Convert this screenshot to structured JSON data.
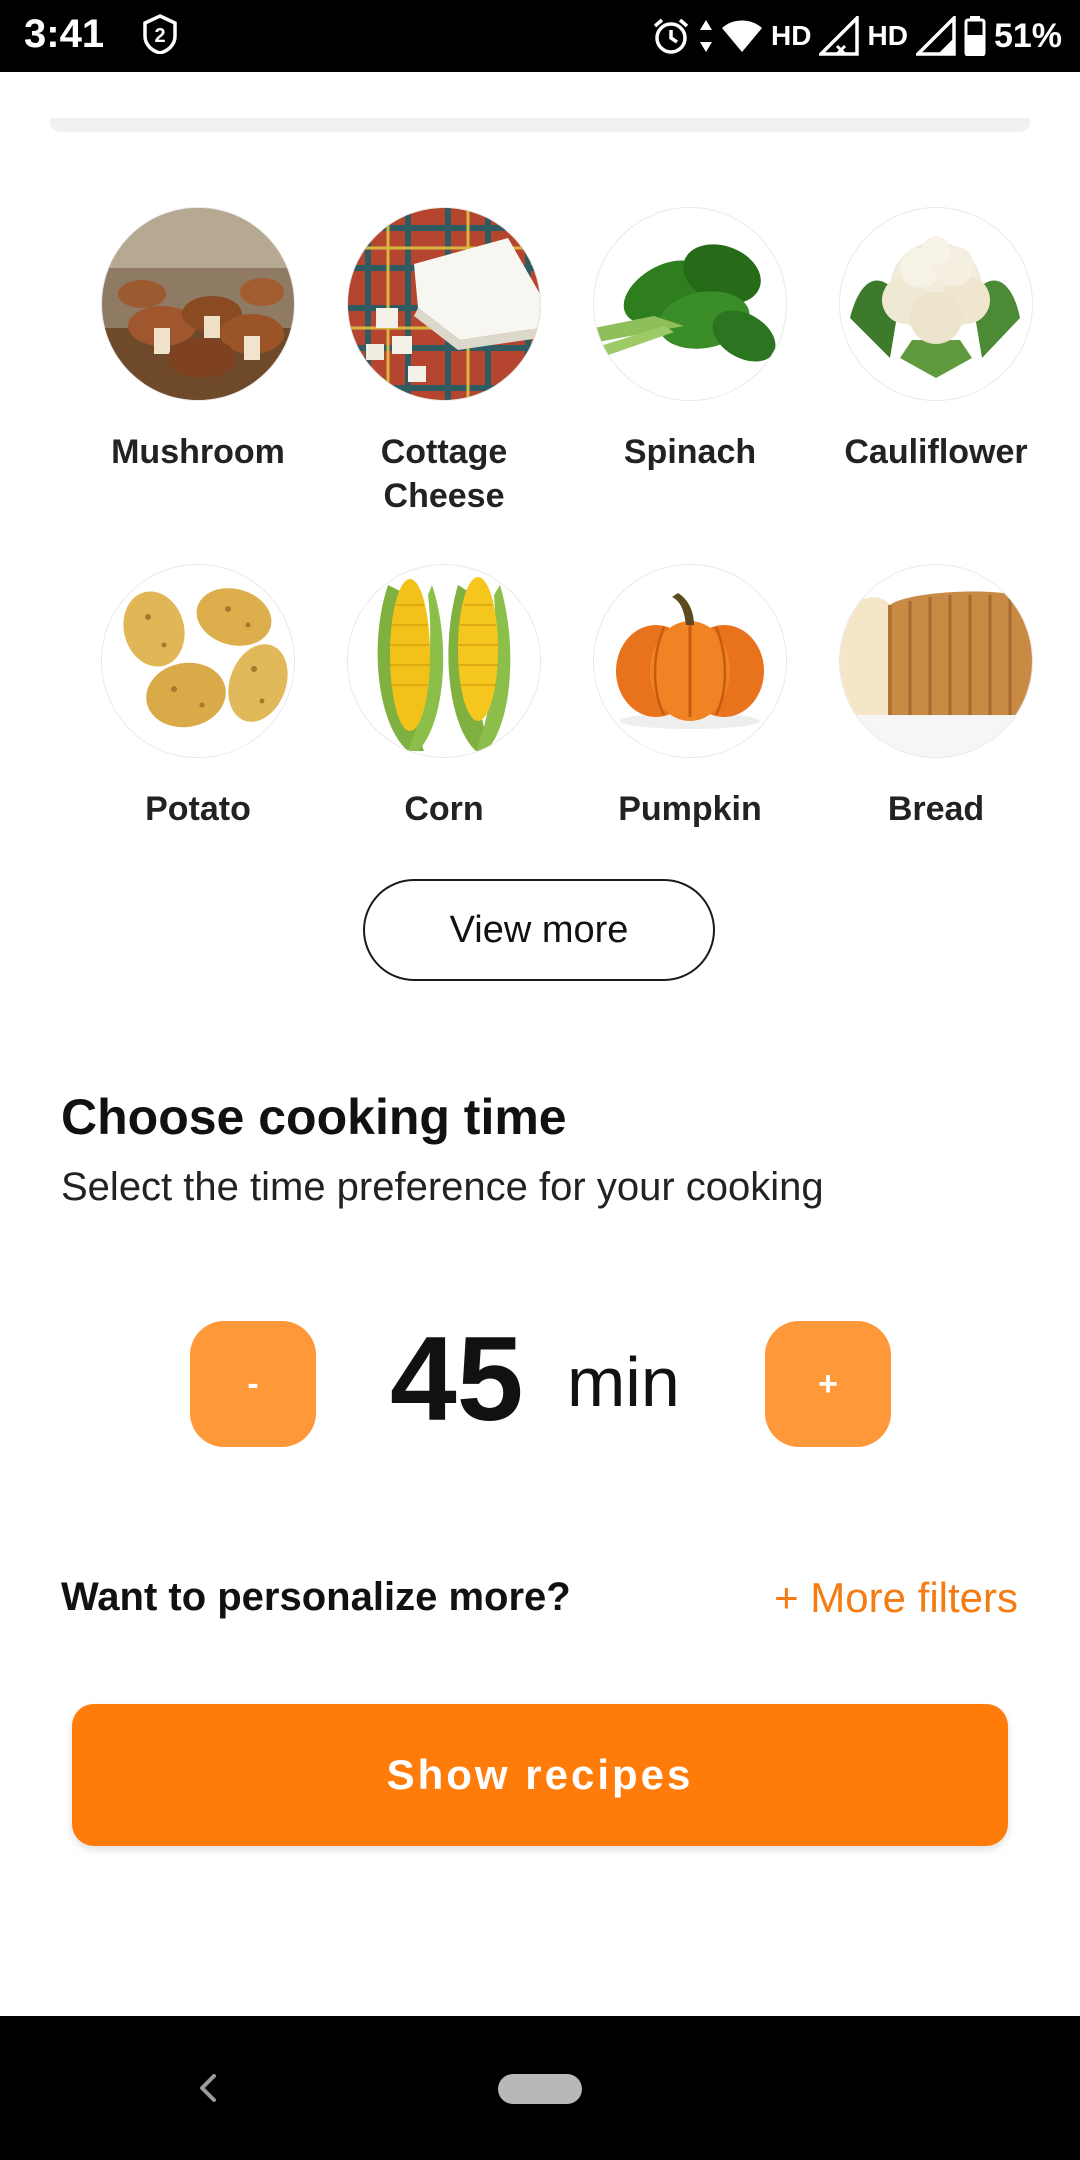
{
  "status_bar": {
    "time": "3:41",
    "badge_number": "2",
    "network_1": "HD",
    "network_2": "HD",
    "battery": "51%"
  },
  "ingredients": [
    {
      "label": "Mushroom",
      "icon": "mushroom-image"
    },
    {
      "label": "Cottage\nCheese",
      "icon": "cottage-cheese-image"
    },
    {
      "label": "Spinach",
      "icon": "spinach-image"
    },
    {
      "label": "Cauliflower",
      "icon": "cauliflower-image"
    },
    {
      "label": "Potato",
      "icon": "potato-image"
    },
    {
      "label": "Corn",
      "icon": "corn-image"
    },
    {
      "label": "Pumpkin",
      "icon": "pumpkin-image"
    },
    {
      "label": "Bread",
      "icon": "bread-image"
    }
  ],
  "view_more_label": "View more",
  "cooking_time": {
    "title": "Choose cooking time",
    "subtitle": "Select the time preference for your cooking",
    "decrement_label": "-",
    "increment_label": "+",
    "value": "45",
    "unit": "min"
  },
  "personalize": {
    "question": "Want to personalize more?",
    "link": "+ More filters"
  },
  "show_recipes_label": "Show recipes",
  "colors": {
    "accent": "#ff7b0a",
    "stepper": "#ff9839",
    "link": "#f57c13"
  }
}
